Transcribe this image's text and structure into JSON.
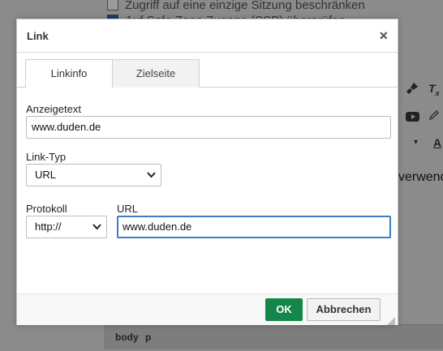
{
  "background": {
    "check_items": [
      {
        "label": "Zugriff auf eine einzige Sitzung beschränken",
        "checked": false
      },
      {
        "label": "Auf Safe Zone Zugang (SSP) überprüfen",
        "checked": true
      }
    ],
    "editor_text_fragment": "verwend",
    "statusbar": {
      "path_1": "body",
      "path_2": "p"
    }
  },
  "dialog": {
    "title": "Link",
    "close_symbol": "×",
    "tabs": [
      {
        "label": "Linkinfo",
        "active": true
      },
      {
        "label": "Zielseite",
        "active": false
      }
    ],
    "display_text": {
      "label": "Anzeigetext",
      "value": "www.duden.de"
    },
    "link_type": {
      "label": "Link-Typ",
      "selected": "URL"
    },
    "protocol": {
      "label": "Protokoll",
      "selected": "http://"
    },
    "url": {
      "label": "URL",
      "value": "www.duden.de"
    },
    "buttons": {
      "ok": "OK",
      "cancel": "Abbrechen"
    }
  },
  "colors": {
    "ok_button": "#13874b",
    "focus_border": "#3d7fc2",
    "overlay": "#8b8b8b"
  }
}
